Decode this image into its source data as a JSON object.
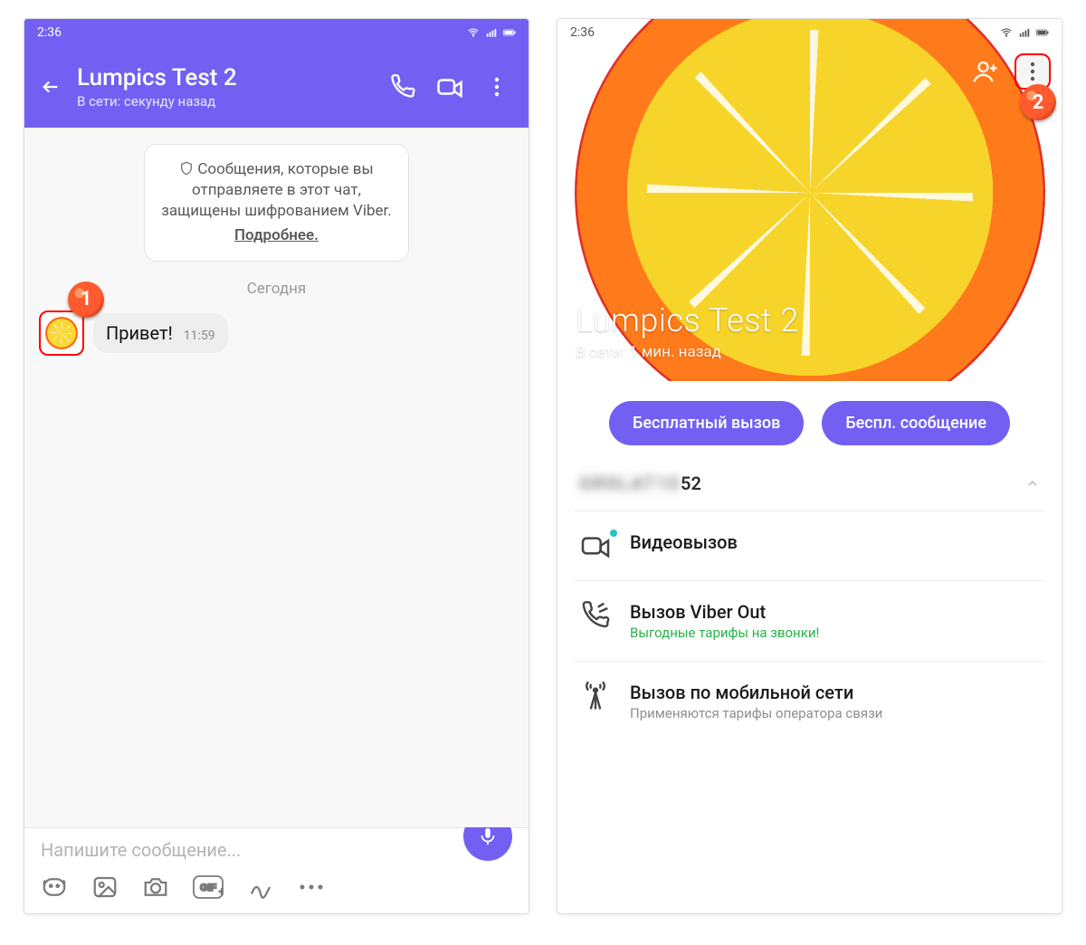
{
  "statusbar_time": "2:36",
  "left": {
    "chat_title": "Lumpics Test 2",
    "chat_status": "В сети: секунду назад",
    "encryption_line1": "Сообщения, которые вы",
    "encryption_line2": "отправляете в этот чат,",
    "encryption_line3": "защищены шифрованием Viber.",
    "encryption_more": "Подробнее.",
    "date_separator": "Сегодня",
    "message_text": "Привет!",
    "message_time": "11:59",
    "input_placeholder": "Напишите сообщение...",
    "callout_label": "1"
  },
  "right": {
    "profile_name": "Lumpics Test 2",
    "profile_status": "В сети: 1 мин. назад",
    "free_call_button": "Бесплатный вызов",
    "free_message_button": "Беспл. сообщение",
    "phone_blur_prefix": "GR0LAT10",
    "phone_tail": "52",
    "options": [
      {
        "label": "Видеовызов",
        "sub": ""
      },
      {
        "label": "Вызов Viber Out",
        "sub": "Выгодные тарифы на звонки!",
        "sub_green": true
      },
      {
        "label": "Вызов по мобильной сети",
        "sub": "Применяются тарифы оператора связи"
      }
    ],
    "callout_label": "2"
  }
}
